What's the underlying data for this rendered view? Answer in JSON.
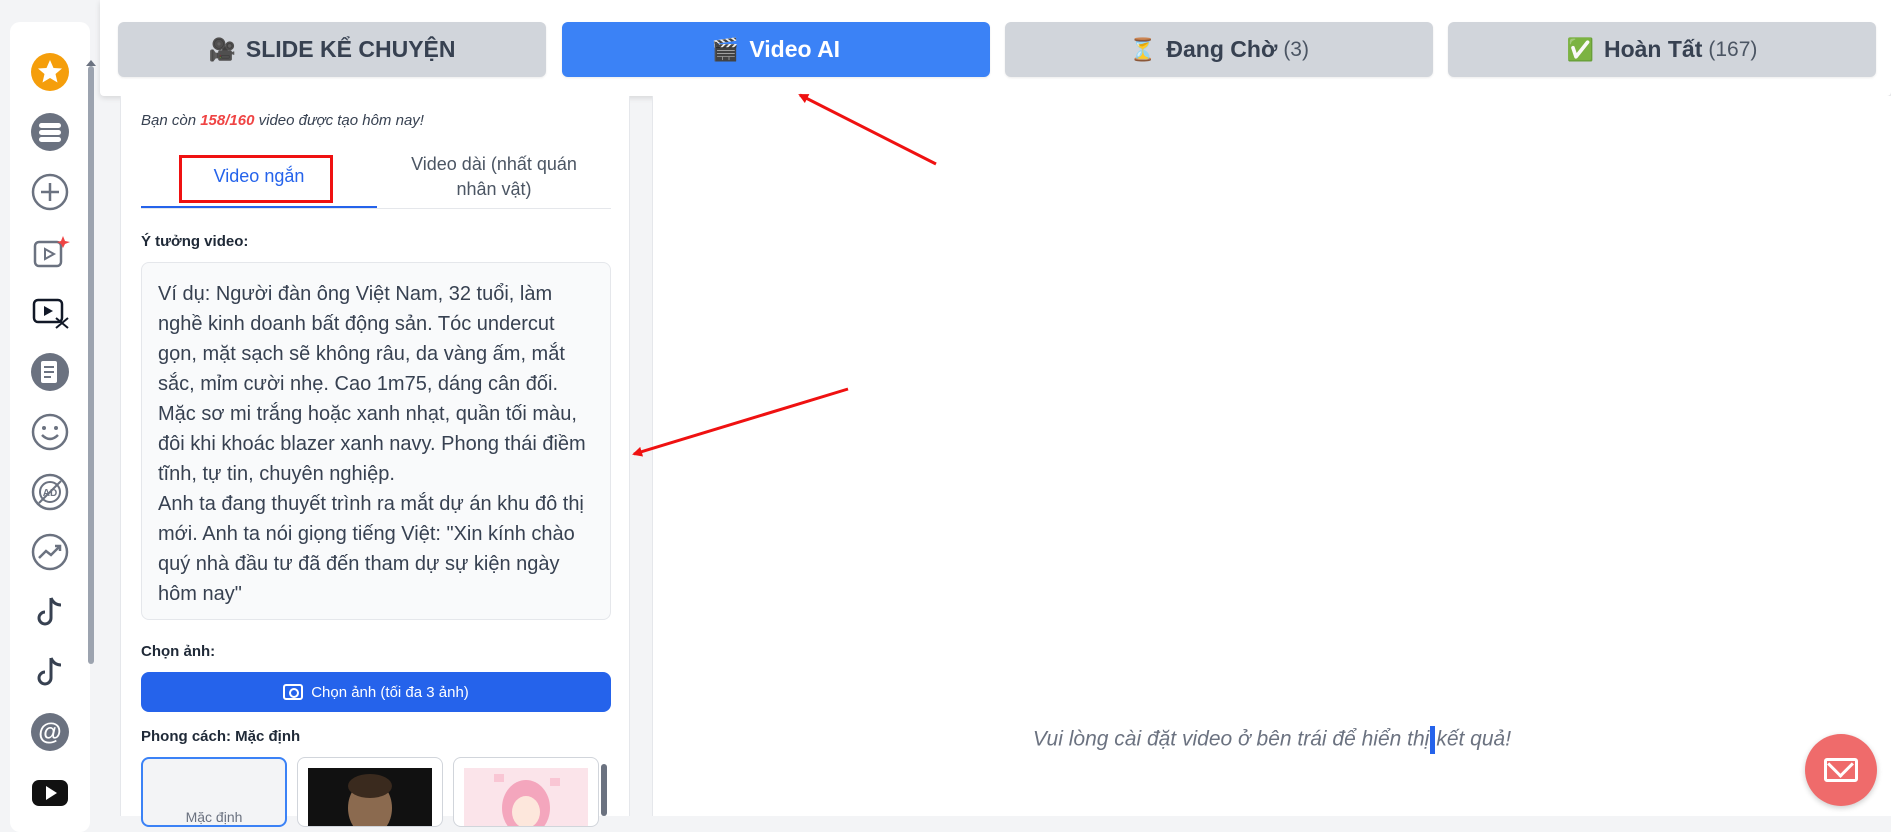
{
  "sidebar": {
    "icons": [
      "star-icon",
      "stack-icon",
      "add-circle-icon",
      "video-sparkle-icon",
      "video-edit-icon",
      "document-icon",
      "smile-icon",
      "ad-block-icon",
      "trending-icon",
      "tiktok-icon",
      "tiktok-alt-icon",
      "threads-icon",
      "youtube-icon"
    ]
  },
  "tabs": [
    {
      "label": "SLIDE KỂ CHUYỆN",
      "icon": "🎥",
      "count": ""
    },
    {
      "label": "Video AI",
      "icon": "🎬",
      "count": ""
    },
    {
      "label": "Đang Chờ",
      "icon": "⏳",
      "count": "(3)"
    },
    {
      "label": "Hoàn Tất",
      "icon": "✅",
      "count": "(167)"
    }
  ],
  "quota": {
    "prefix": "Bạn còn ",
    "value": "158/160",
    "suffix": " video được tạo hôm nay!"
  },
  "subtabs": {
    "short": "Video ngắn",
    "long": "Video dài (nhất quán nhân vật)"
  },
  "idea": {
    "label": "Ý tưởng video:",
    "placeholder": "Ví dụ: Người đàn ông Việt Nam, 32 tuổi, làm nghề kinh doanh bất động sản. Tóc undercut gọn, mặt sạch sẽ không râu, da vàng ấm, mắt sắc, mỉm cười nhẹ. Cao 1m75, dáng cân đối. Mặc sơ mi trắng hoặc xanh nhạt, quần tối màu, đôi khi khoác blazer xanh navy. Phong thái điềm tĩnh, tự tin, chuyên nghiệp.\nAnh ta đang thuyết trình ra mắt dự án khu đô thị mới. Anh ta nói giọng tiếng Việt: \"Xin kính chào quý nhà đầu tư đã đến tham dự sự kiện ngày hôm nay\""
  },
  "image": {
    "label": "Chọn ảnh:",
    "button": "Chọn ảnh (tối đa 3 ảnh)"
  },
  "style": {
    "label": "Phong cách: Mặc định",
    "default_option": "Mặc định"
  },
  "result": {
    "before": "Vui lòng cài đặt video ở bên trái để hiển thị",
    "after": "kết quả!"
  },
  "colors": {
    "accent": "#3b82f6",
    "primary_button": "#2563eb",
    "quota_highlight": "#ef4444",
    "annotation": "#ef1111",
    "fab": "#ef6b6b"
  }
}
